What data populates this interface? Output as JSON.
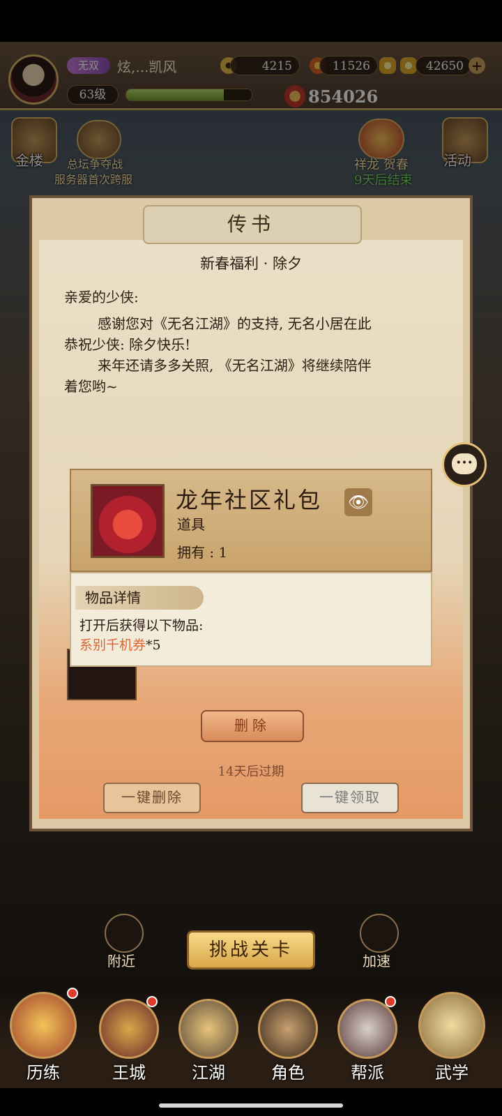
{
  "header": {
    "badge": "无双",
    "player_name": "炫,...凯风",
    "level": "63级",
    "xp_fraction": 0.78,
    "copper": "4215",
    "stamina": "11526",
    "gold": "42650",
    "power": "854026"
  },
  "side_icons": {
    "gold_tower": "金楼",
    "event_title": "总坛争夺战",
    "event_sub": "服务器首次跨服",
    "dragon_title": "祥龙 贺春",
    "dragon_sub": "9天后结束",
    "activity": "活动"
  },
  "dialog": {
    "title": "传书",
    "subject": "新春福利 · 除夕",
    "greeting": "亲爱的少侠:",
    "para1_line1": "感谢您对《无名江湖》的支持, 无名小居在此",
    "para1_line2": "恭祝少侠: 除夕快乐!",
    "para2_line1": "来年还请多多关照, 《无名江湖》将继续陪伴",
    "para2_line2": "着您哟~",
    "delete_label": "删除",
    "expire": "14天后过期",
    "delete_all_label": "一键删除",
    "get_all_label": "一键领取"
  },
  "item_popup": {
    "name": "龙年社区礼包",
    "type": "道具",
    "owned": "拥有 : 1",
    "detail_tag": "物品详情",
    "description": "打开后获得以下物品:",
    "reward_name": "系别千机券",
    "reward_qty": "*5"
  },
  "bottom": {
    "challenge_label": "挑战关卡",
    "nearby": "附近",
    "speedup": "加速"
  },
  "navbar": {
    "items": [
      {
        "label": "历练",
        "badge": true
      },
      {
        "label": "王城",
        "badge": true
      },
      {
        "label": "江湖",
        "badge": false
      },
      {
        "label": "角色",
        "badge": false
      },
      {
        "label": "帮派",
        "badge": true
      },
      {
        "label": "武学",
        "badge": false
      }
    ]
  },
  "colors": {
    "highlight_orange": "#e0632e",
    "frame_brown": "#6b5136",
    "gold_accent": "#d9b26a"
  }
}
